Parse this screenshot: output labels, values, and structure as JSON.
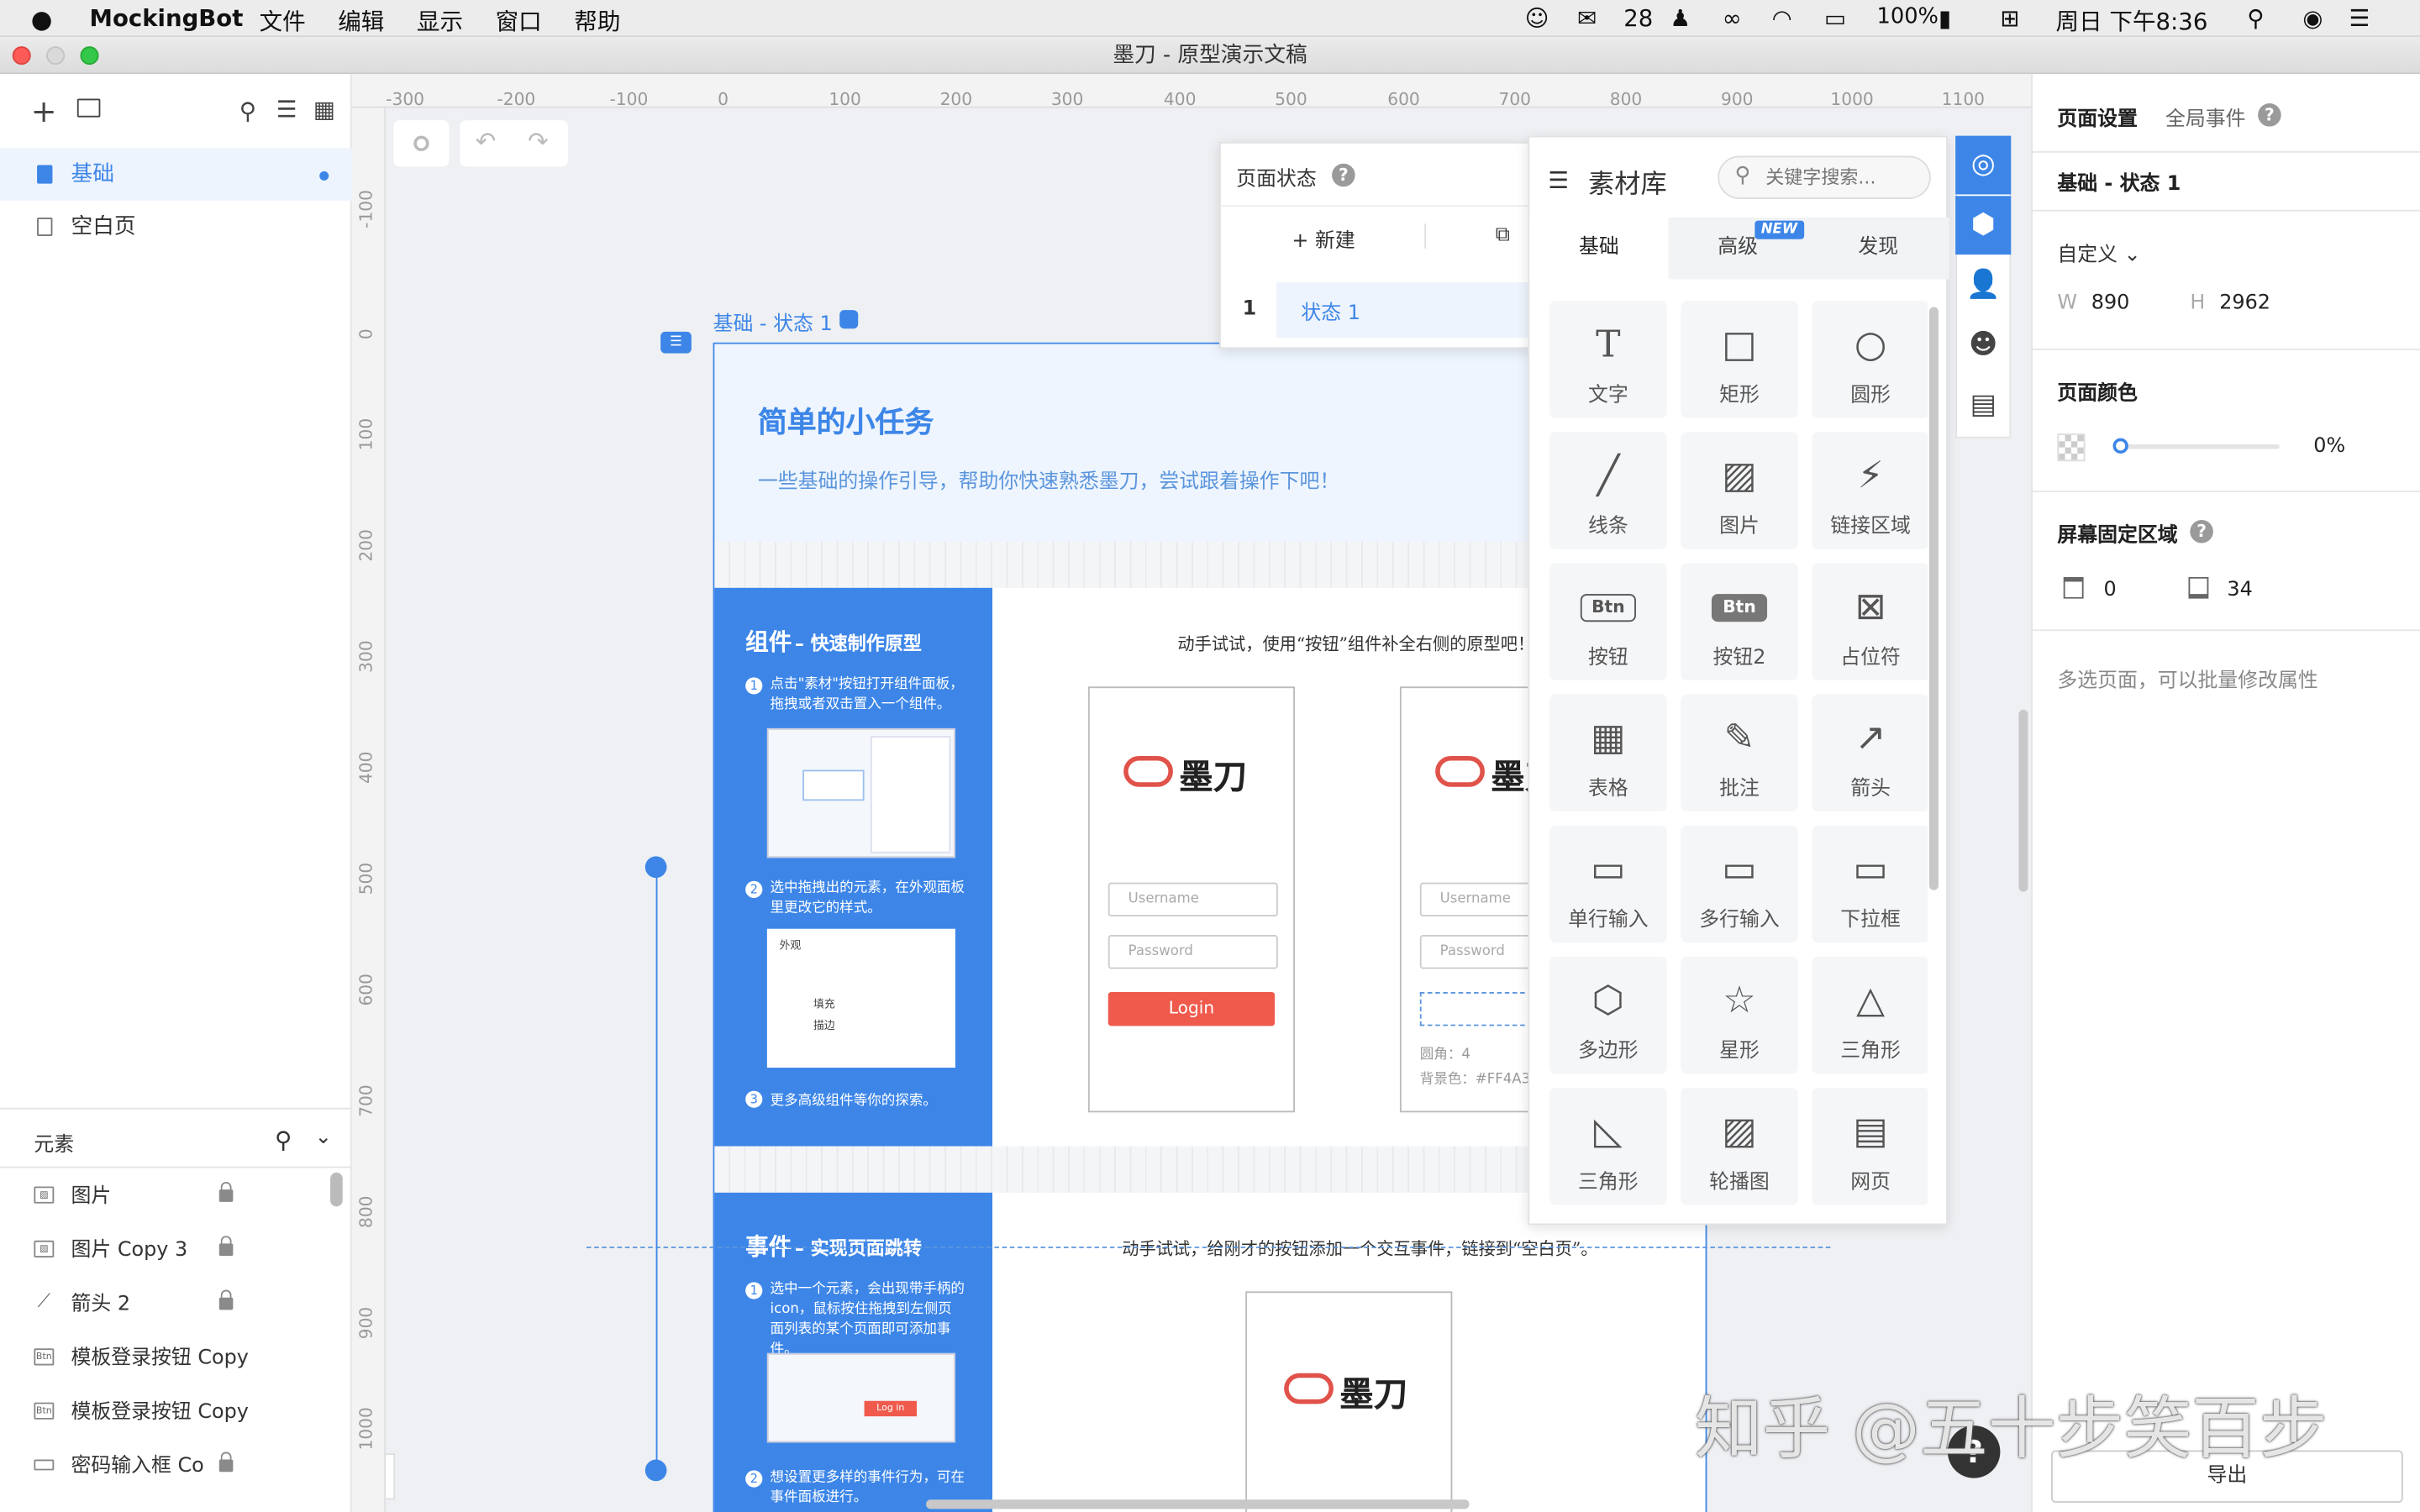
{
  "menubar": {
    "app_name": "MockingBot",
    "menus": [
      "文件",
      "编辑",
      "显示",
      "窗口",
      "帮助"
    ],
    "wechat_count": "28",
    "battery": "100%",
    "clock": "周日 下午8:36"
  },
  "window": {
    "title": "墨刀 - 原型演示文稿"
  },
  "left_panel": {
    "pages": [
      {
        "label": "基础",
        "active": true
      },
      {
        "label": "空白页",
        "active": false
      }
    ],
    "elements_header": "元素",
    "elements": [
      {
        "label": "图片",
        "icon": "image-icon",
        "locked": true
      },
      {
        "label": "图片 Copy 3",
        "icon": "image-icon",
        "locked": true
      },
      {
        "label": "箭头 2",
        "icon": "arrow-icon",
        "locked": true
      },
      {
        "label": "模板登录按钮 Copy",
        "icon": "btn-icon",
        "locked": false
      },
      {
        "label": "模板登录按钮 Copy",
        "icon": "btn-icon",
        "locked": false
      },
      {
        "label": "密码输入框 Co",
        "icon": "input-icon",
        "locked": true
      }
    ]
  },
  "rulers": {
    "h_ticks": [
      "-300",
      "-200",
      "-100",
      "0",
      "100",
      "200",
      "300",
      "400",
      "500",
      "600",
      "700",
      "800",
      "900",
      "1000",
      "1100"
    ],
    "v_ticks": [
      "-100",
      "0",
      "100",
      "200",
      "300",
      "400",
      "500",
      "600",
      "700",
      "800",
      "900",
      "1000"
    ]
  },
  "canvas": {
    "artboard_label": "基础 - 状态 1",
    "hero_title": "简单的小任务",
    "hero_subtitle": "一些基础的操作引导，帮助你快速熟悉墨刀，尝试跟着操作下吧！",
    "section1": {
      "title": "组件",
      "subtitle": "– 快速制作原型",
      "step1": "点击\"素材\"按钮打开组件面板，拖拽或者双击置入一个组件。",
      "step2": "选中拖拽出的元素，在外观面板里更改它的样式。",
      "step3": "更多高级组件等你的探索。",
      "appearance_title": "外观",
      "appearance_fill": "填充",
      "appearance_stroke": "描边",
      "instruction": "动手试试，使用“按钮”组件补全右侧的原型吧！",
      "logo_text": "墨刀",
      "username_ph": "Username",
      "password_ph": "Password",
      "login_label": "Login",
      "radius_note": "圆角：4",
      "bg_note": "背景色：#FF4A3"
    },
    "section2": {
      "title": "事件",
      "subtitle": "– 实现页面跳转",
      "step1": "选中一个元素，会出现带手柄的icon，鼠标按住拖拽到左侧页面列表的某个页面即可添加事件。",
      "step2": "想设置更多样的事件行为，可在事件面板进行。",
      "instruction": "动手试试，给刚才的按钮添加一个交互事件，链接到“空白页”。",
      "logo_text": "墨刀",
      "mini_login": "Log in"
    }
  },
  "page_state": {
    "title": "页面状态",
    "new_label": "新建",
    "row_num": "1",
    "row_label": "状态 1"
  },
  "library": {
    "title": "素材库",
    "search_placeholder": "关键字搜索...",
    "tabs": [
      "基础",
      "高级",
      "发现"
    ],
    "new_badge": "NEW",
    "items": [
      {
        "label": "文字",
        "glyph": "T"
      },
      {
        "label": "矩形",
        "glyph": "□"
      },
      {
        "label": "圆形",
        "glyph": "○"
      },
      {
        "label": "线条",
        "glyph": "╱"
      },
      {
        "label": "图片",
        "glyph": "▨"
      },
      {
        "label": "链接区域",
        "glyph": "⚡"
      },
      {
        "label": "按钮",
        "glyph": "Btn"
      },
      {
        "label": "按钮2",
        "glyph": "Btn"
      },
      {
        "label": "占位符",
        "glyph": "⊠"
      },
      {
        "label": "表格",
        "glyph": "▦"
      },
      {
        "label": "批注",
        "glyph": "✎"
      },
      {
        "label": "箭头",
        "glyph": "↗"
      },
      {
        "label": "单行输入",
        "glyph": "▭"
      },
      {
        "label": "多行输入",
        "glyph": "▭"
      },
      {
        "label": "下拉框",
        "glyph": "▭"
      },
      {
        "label": "多边形",
        "glyph": "⬡"
      },
      {
        "label": "星形",
        "glyph": "☆"
      },
      {
        "label": "三角形",
        "glyph": "△"
      },
      {
        "label": "三角形",
        "glyph": "◺"
      },
      {
        "label": "轮播图",
        "glyph": "▨"
      },
      {
        "label": "网页",
        "glyph": "▤"
      }
    ]
  },
  "right_panel": {
    "tabs": [
      "页面设置",
      "全局事件"
    ],
    "state_name": "基础 - 状态 1",
    "size_mode": "自定义",
    "w_label": "W",
    "w_value": "890",
    "h_label": "H",
    "h_value": "2962",
    "page_color_title": "页面颜色",
    "opacity": "0%",
    "fixed_area_title": "屏幕固定区域",
    "fixed_top": "0",
    "fixed_bottom": "34",
    "hint": "多选页面，可以批量修改属性",
    "export_label": "导出"
  },
  "watermark": "知乎 @五十步笑百步",
  "colors": {
    "accent": "#3d86e8",
    "login": "#ef5a4c",
    "library_side": "#3d86e8"
  }
}
